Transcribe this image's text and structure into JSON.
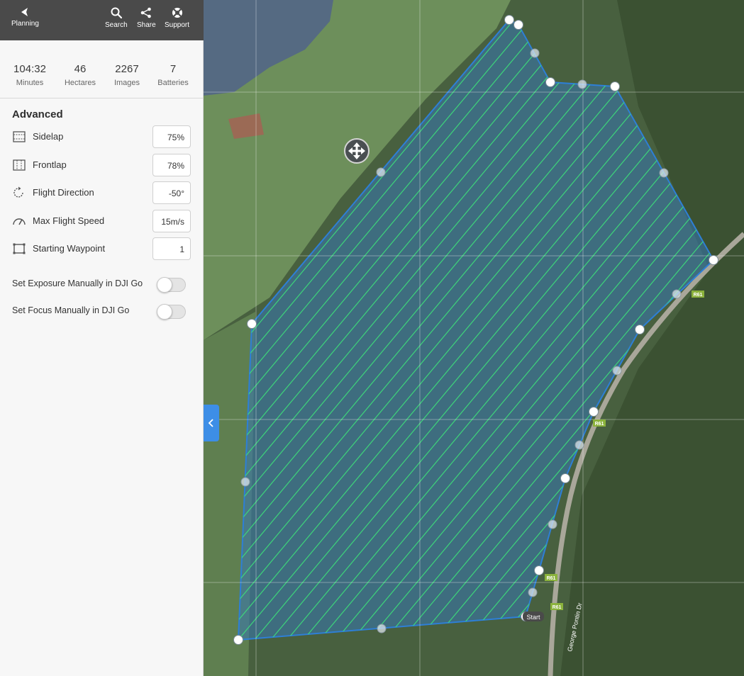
{
  "topbar": {
    "planning_label": "Planning",
    "search_label": "Search",
    "share_label": "Share",
    "support_label": "Support"
  },
  "stats": [
    {
      "value": "104:32",
      "label": "Minutes"
    },
    {
      "value": "46",
      "label": "Hectares"
    },
    {
      "value": "2267",
      "label": "Images"
    },
    {
      "value": "7",
      "label": "Batteries"
    }
  ],
  "advanced": {
    "title": "Advanced",
    "settings": [
      {
        "label": "Sidelap",
        "value": "75%",
        "icon": "sidelap-icon"
      },
      {
        "label": "Frontlap",
        "value": "78%",
        "icon": "frontlap-icon"
      },
      {
        "label": "Flight Direction",
        "value": "-50°",
        "icon": "rotate-icon"
      },
      {
        "label": "Max Flight Speed",
        "value": "15m/s",
        "icon": "speedometer-icon"
      },
      {
        "label": "Starting Waypoint",
        "value": "1",
        "icon": "waypoint-loop-icon"
      }
    ],
    "toggles": [
      {
        "label": "Set Exposure Manually in DJI Go",
        "on": false
      },
      {
        "label": "Set Focus Manually in DJI Go",
        "on": false
      }
    ]
  },
  "map": {
    "start_label": "Start",
    "road_labels": [
      "R61",
      "R61",
      "R61",
      "R61"
    ],
    "street_label": "George Pontin Dr",
    "accent_color": "#3d8ee6",
    "polygon_stroke": "#2e7fd6",
    "flight_line_color": "#3ee07a"
  },
  "colors": {
    "topbar_bg": "#4a4a4a",
    "sidebar_bg": "#f7f7f7",
    "collapse_tab": "#3d8ee6"
  }
}
